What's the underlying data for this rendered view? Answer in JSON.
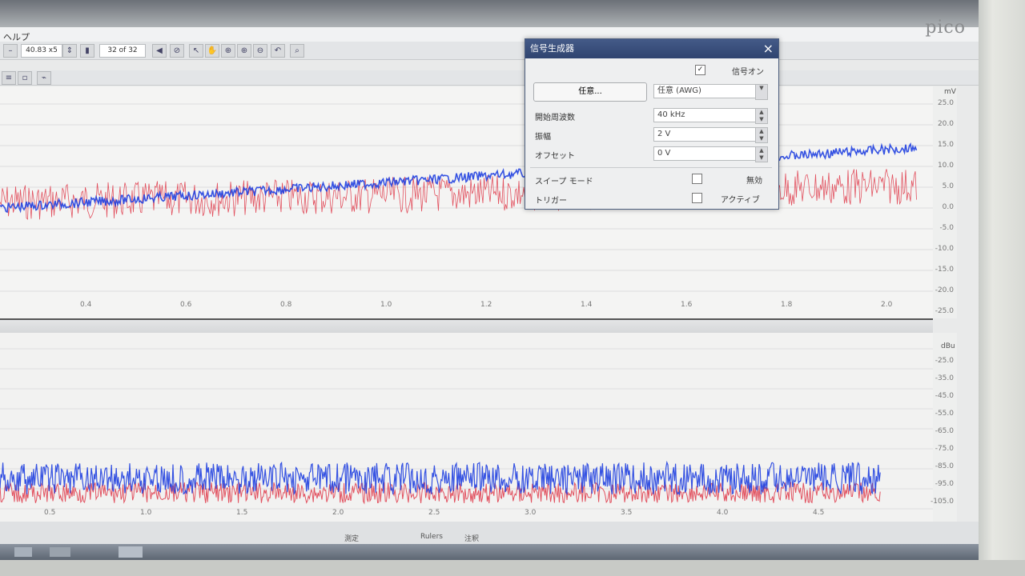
{
  "app": {
    "menu_label": "ヘルプ",
    "brand": "pico"
  },
  "toolbar": {
    "timebase": "40.83 x5",
    "capture_counter": "32 of 32"
  },
  "signal_generator": {
    "title": "信号生成器",
    "signal_on_label": "信号オン",
    "signal_on_checked": "✓",
    "type_button": "任意...",
    "waveform_select": "任意 (AWG)",
    "start_freq_label": "開始周波数",
    "start_freq_value": "40 kHz",
    "amplitude_label": "振幅",
    "amplitude_value": "2 V",
    "offset_label": "オフセット",
    "offset_value": "0 V",
    "sweep_mode_label": "スイープ モード",
    "sweep_mode_state": "無効",
    "trigger_label": "トリガー",
    "trigger_state": "アクティブ"
  },
  "scope_view": {
    "unit": "mV",
    "y_ticks": [
      "25.0",
      "20.0",
      "15.0",
      "10.0",
      "5.0",
      "0.0",
      "-5.0",
      "-10.0",
      "-15.0",
      "-20.0",
      "-25.0"
    ],
    "x_ticks": [
      "0.4",
      "0.6",
      "0.8",
      "1.0",
      "1.2",
      "1.4",
      "1.6",
      "1.8",
      "2.0"
    ]
  },
  "spectrum_view": {
    "unit": "dBu",
    "y_ticks": [
      "-25.0",
      "-35.0",
      "-45.0",
      "-55.0",
      "-65.0",
      "-75.0",
      "-85.0",
      "-95.0",
      "-105.0"
    ],
    "x_ticks": [
      "0.5",
      "1.0",
      "1.5",
      "2.0",
      "2.5",
      "3.0",
      "3.5",
      "4.0",
      "4.5"
    ]
  },
  "statusbar": {
    "left_item": "測定",
    "mid_item": "Rulers",
    "right_item": "注釈"
  },
  "colors": {
    "channel_a": "#2040e0",
    "channel_b": "#e04050"
  }
}
